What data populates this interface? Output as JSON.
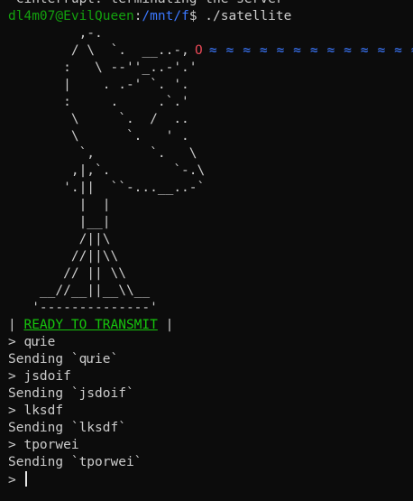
{
  "terminal": {
    "previous_output": "^Cinterrupt: terminating the server",
    "prompt": {
      "user_host": "dl4m07@EvilQueen",
      "separator": ":",
      "path": "/mnt/f",
      "symbol": "$",
      "command": "./satellite"
    },
    "ascii_art": "         ,-.\n        / \\  `.  __..-,\n       :   \\ --''_..-'.'\n       |    . .-' `. '.\n       :     .     .`.'\n        \\     `.  /  ..\n        \\      `.   ' .\n         `,       `.   \\\n        ,|,`.        `-.\\\n       '.||  ``-...__..-`\n         |  |\n         |__|\n         /||\\\n        //||\\\\\n       // || \\\\\n    __//__||__\\\\__\n   '--------------'",
    "signal": {
      "source": "O",
      "waves": "≈ ≈ ≈ ≈ ≈ ≈ ≈ ≈ ≈ ≈ ≈ ≈ ≈"
    },
    "status": {
      "left_bar": "| ",
      "label": "READY TO TRANSMIT",
      "right_bar": " |"
    },
    "log": [
      {
        "input": "> qưie",
        "output": "Sending `qưie`"
      },
      {
        "input": "> jsdoif",
        "output": "Sending `jsdoif`"
      },
      {
        "input": "> lksdf",
        "output": "Sending `lksdf`"
      },
      {
        "input": "> tporwei",
        "output": "Sending `tporwei`"
      }
    ],
    "input_prompt": "> ",
    "input_value": ""
  },
  "colors": {
    "background": "#0c0c0c",
    "foreground": "#cccccc",
    "user_host": "#13a10e",
    "path": "#3b78ff",
    "ready": "#16c60c",
    "signal_source": "#e74856",
    "signal_waves": "#3b78ff"
  }
}
